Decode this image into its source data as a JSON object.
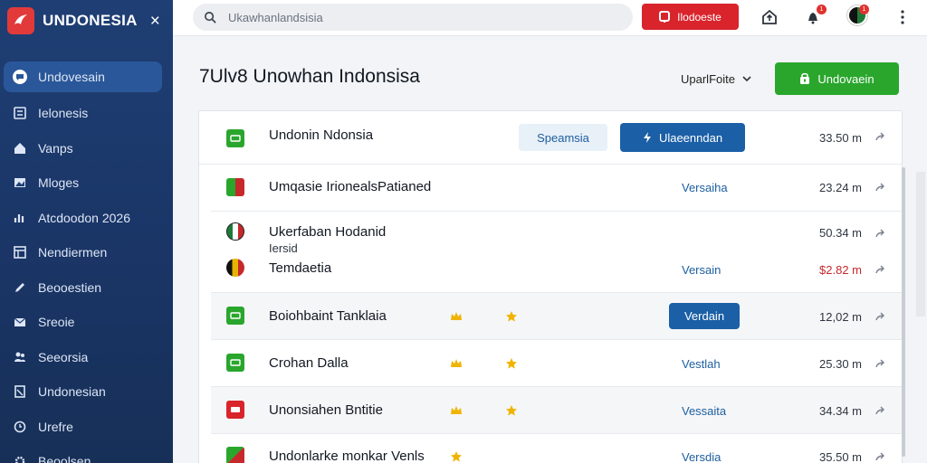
{
  "sidebar": {
    "brand": "UNDONESIA",
    "close": "×",
    "items": [
      {
        "label": "Undovesain",
        "icon": "chat-icon",
        "active": true
      },
      {
        "label": "Ielonesis",
        "icon": "list-icon"
      },
      {
        "label": "Vanps",
        "icon": "home-icon"
      },
      {
        "label": "Mloges",
        "icon": "image-icon"
      },
      {
        "label": "Atcdoodon 2026",
        "icon": "chart-icon"
      },
      {
        "label": "Nendiermen",
        "icon": "table-icon"
      },
      {
        "label": "Beooestien",
        "icon": "pen-icon"
      },
      {
        "label": "Sreoie",
        "icon": "mail-icon"
      },
      {
        "label": "Seeorsia",
        "icon": "users-icon"
      },
      {
        "label": "Undonesian",
        "icon": "doc-icon"
      },
      {
        "label": "Urefre",
        "icon": "clock-icon"
      },
      {
        "label": "Beoolsen",
        "icon": "gear-icon"
      }
    ]
  },
  "topbar": {
    "search_placeholder": "Ukawhanlandsisia",
    "red_button": "Ilodoeste",
    "bell_badge": "1",
    "avatar_badge": "1"
  },
  "main": {
    "title": "7Ulv8 Unowhan Indonsisa",
    "filter_label": "UparlFoite",
    "primary_button": "Undovaein"
  },
  "rows": [
    {
      "name": "Undonin Ndonsia",
      "chip1": "Speamsia",
      "chip2": "Ulaeenndan",
      "size": "33.50 m",
      "icon_color": "#2aa62d"
    },
    {
      "name": "Umqasie IrionealsPatianed",
      "status": "Versaiha",
      "size": "23.24 m",
      "icon_color": "#2aa62d"
    },
    {
      "name": "Ukerfaban Hodanid",
      "sub": "Iersid",
      "name2": "Temdaetia",
      "status": "Versain",
      "size": "50.34 m",
      "size2": "$2.82 m",
      "icon_color": "#c7282b"
    },
    {
      "name": "Boiohbaint Tanklaia",
      "chip_blue": "Verdain",
      "size": "12,02 m",
      "icon_color": "#2aa62d"
    },
    {
      "name": "Crohan Dalla",
      "status": "Vestlah",
      "size": "25.30 m",
      "icon_color": "#2aa62d"
    },
    {
      "name": "Unonsiahen Bntitie",
      "status": "Vessaita",
      "size": "34.34 m",
      "icon_color": "#d9242c"
    },
    {
      "name": "Undonlarke monkar Venls",
      "status": "Versdia",
      "size": "35.50 m",
      "icon_color": "#2aa62d"
    }
  ],
  "colors": {
    "sidebar": "#1f3f74",
    "accent_blue": "#1b5fa6",
    "accent_green": "#2aa62d",
    "accent_red": "#d9242c",
    "star": "#f0b400"
  }
}
